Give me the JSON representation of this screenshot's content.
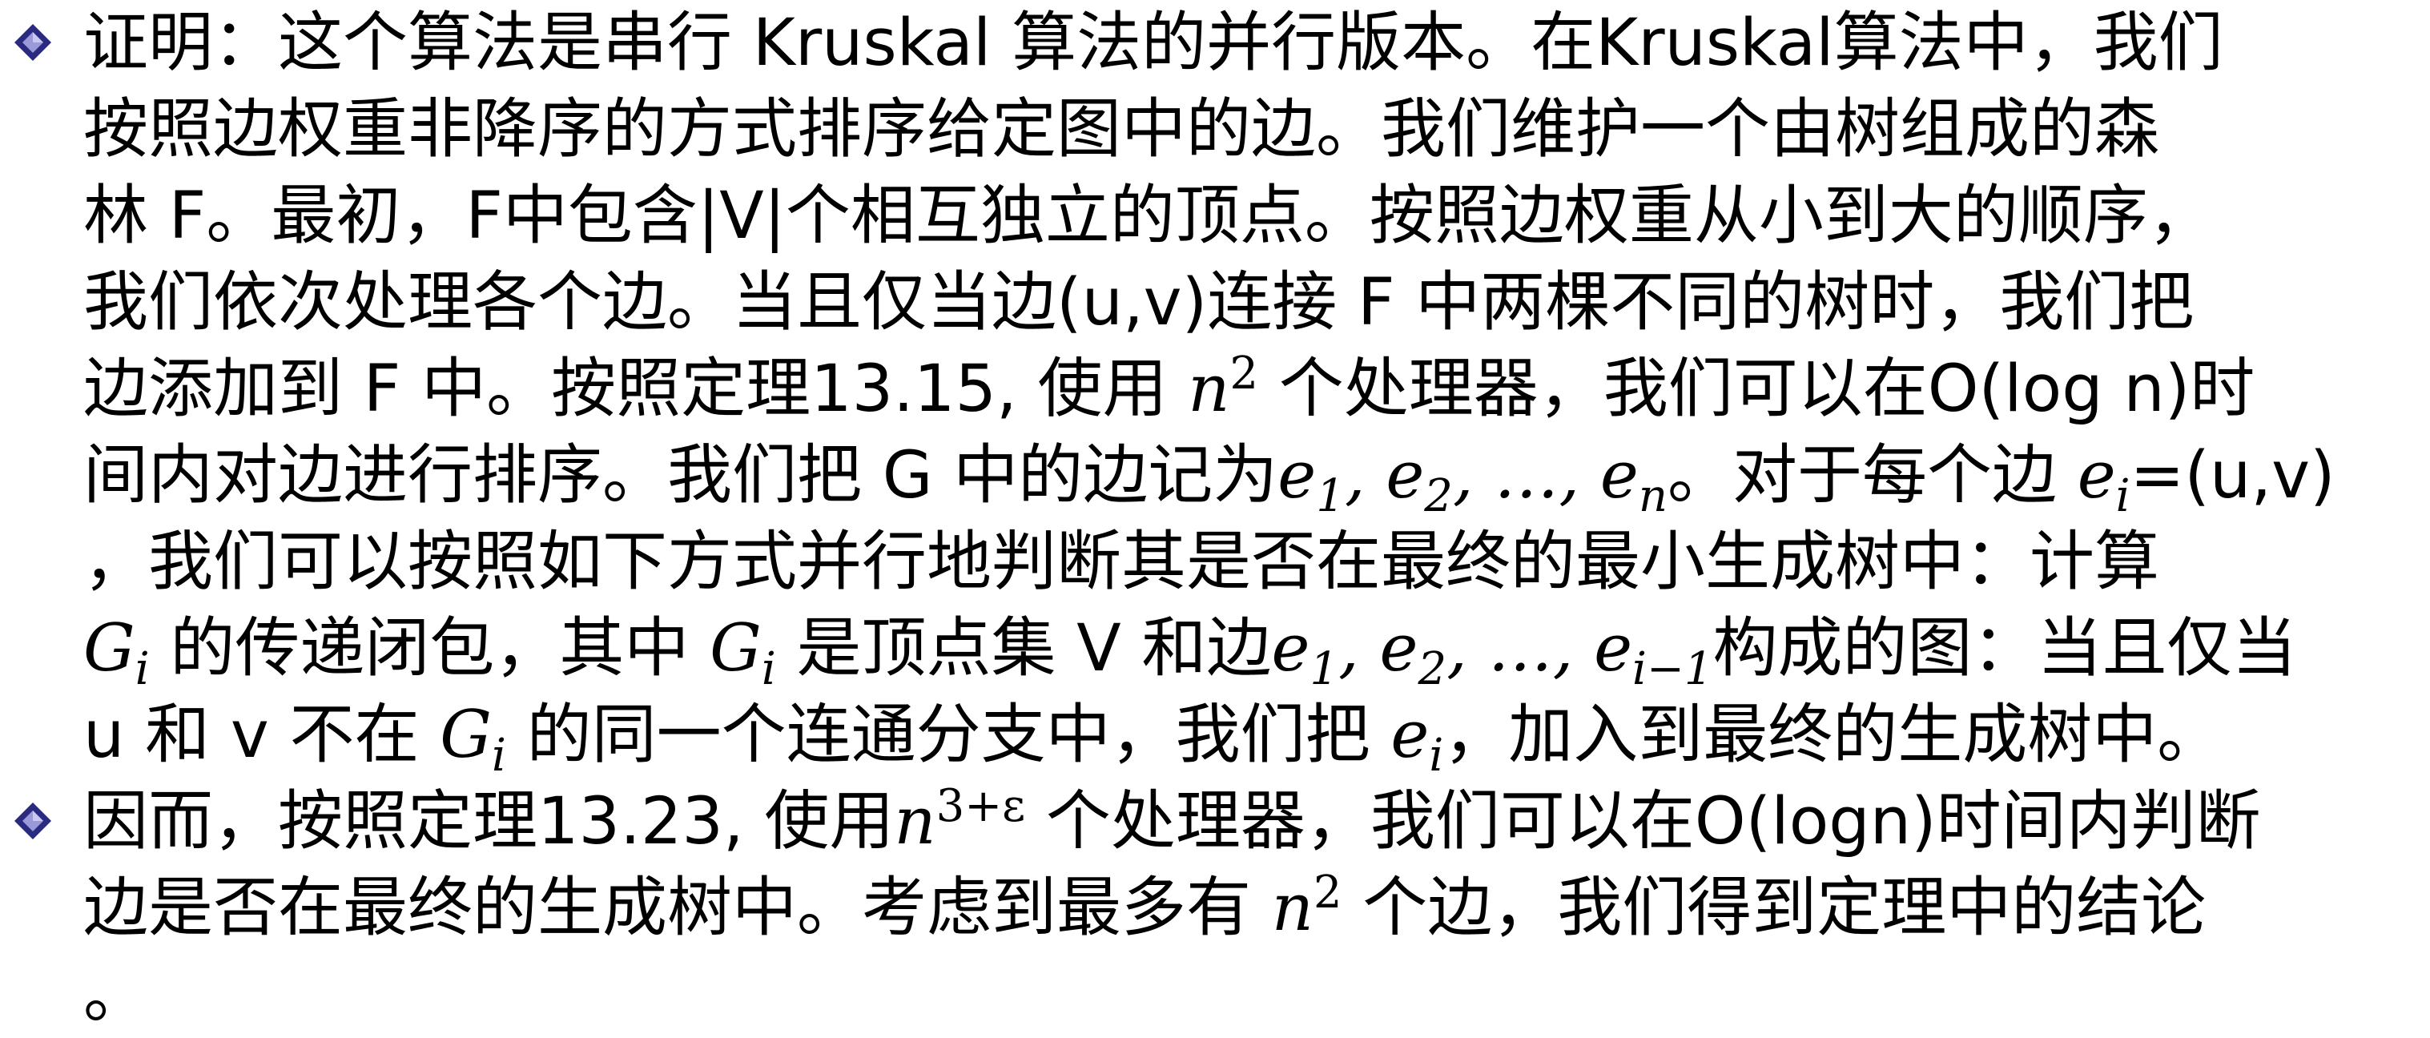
{
  "bullets": [
    {
      "lines": [
        [
          "证明：这个算法是串行 Kruskal 算法的并行版本。在Kruskal算法中，我们"
        ],
        [
          "按照边权重非降序的方式排序给定图中的边。我们维护一个由树组成的森"
        ],
        [
          "林 F。最初，F中包含|V|个相互独立的顶点。按照边权重从小到大的顺序，"
        ],
        [
          "我们依次处理各个边。当且仅当边(u,v)连接 F 中两棵不同的树时，我们把"
        ],
        [
          "边添加到 F 中。按照定理13.15, 使用 ",
          "n",
          "2",
          " 个处理器，我们可以在O(log n)时"
        ],
        [
          "间内对边进行排序。我们把 G 中的边记为",
          "e",
          "1",
          ", ",
          "e",
          "2",
          ", …, ",
          "e",
          "n",
          "。对于每个边 ",
          "e",
          "i",
          "=(u,v)"
        ],
        [
          "，我们可以按照如下方式并行地判断其是否在最终的最小生成树中：计算"
        ],
        [
          "G",
          "i",
          " 的传递闭包，其中 ",
          "G",
          "i",
          " 是顶点集 V 和边",
          "e",
          "1",
          ", ",
          "e",
          "2",
          ", …, ",
          "e",
          "i−1",
          "构成的图：当且仅当"
        ],
        [
          "u 和 v 不在 ",
          "G",
          "i",
          " 的同一个连通分支中，我们把 ",
          "e",
          "i",
          "，加入到最终的生成树中。"
        ]
      ]
    },
    {
      "lines": [
        [
          "因而，按照定理13.23, 使用",
          "n",
          "3+ε",
          " 个处理器，我们可以在O(logn)时间内判断"
        ],
        [
          "边是否在最终的生成树中。考虑到最多有 ",
          "n",
          "2",
          " 个边，我们得到定理中的结论"
        ],
        [
          "。"
        ]
      ]
    }
  ]
}
